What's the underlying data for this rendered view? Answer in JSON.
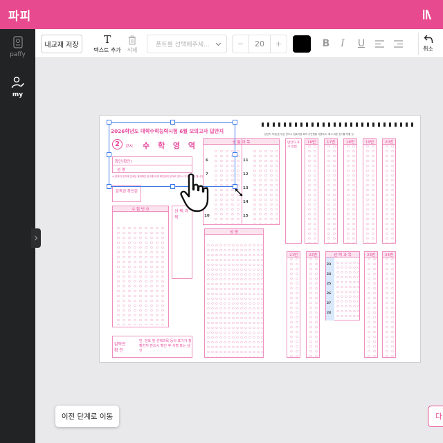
{
  "app": {
    "logo": "파피"
  },
  "sidebar": {
    "items": [
      {
        "label": "paffy"
      },
      {
        "label": "my"
      }
    ]
  },
  "toolbar": {
    "save_label": "내교재 저장",
    "add_text_label": "텍스트 추가",
    "delete_label": "삭제",
    "font_placeholder": "폰트를 선택해주세...",
    "font_size": "20",
    "minus": "−",
    "plus": "+",
    "color": "#000000",
    "undo_label": "취소"
  },
  "sheet": {
    "title": "2026학년도 대학수학능력시험 6월 모의고사 답안지",
    "period_number": "2",
    "period_label": "교시",
    "subject": "수 학 영 역",
    "name_fields": [
      "확인(확인)",
      "성  명"
    ],
    "supervisor_label": "감독관 확인란",
    "exam_number_label": "수  험  번  호",
    "choice_subject_label": "선 택 과 목",
    "name_label": "성  명",
    "common_label": "공 통 과 목",
    "bottom_label": "감독관 확 인",
    "bottom_note": "반, 번호 및 선택과목 등의 표기가 정확한지 반드시 확인 후 서명 또는 날인",
    "question_numbers_left": [
      "6",
      "7",
      "8",
      "9",
      "10"
    ],
    "question_numbers_mid": [
      "11",
      "12",
      "13",
      "14",
      "15"
    ],
    "col_headers": [
      "16번",
      "17번",
      "18번",
      "19번",
      "20번"
    ],
    "col_headers_lower": [
      "21번",
      "22번",
      "23번",
      "24번"
    ],
    "choice_rows": [
      "23",
      "24",
      "25",
      "26",
      "27",
      "28"
    ]
  },
  "footer": {
    "prev_label": "이전 단계로 이동",
    "next_label": "다"
  },
  "colors": {
    "brand": "#e84a8f",
    "sidebar": "#222325",
    "selection": "#3b78e7",
    "omr_pink": "#e8479b"
  }
}
